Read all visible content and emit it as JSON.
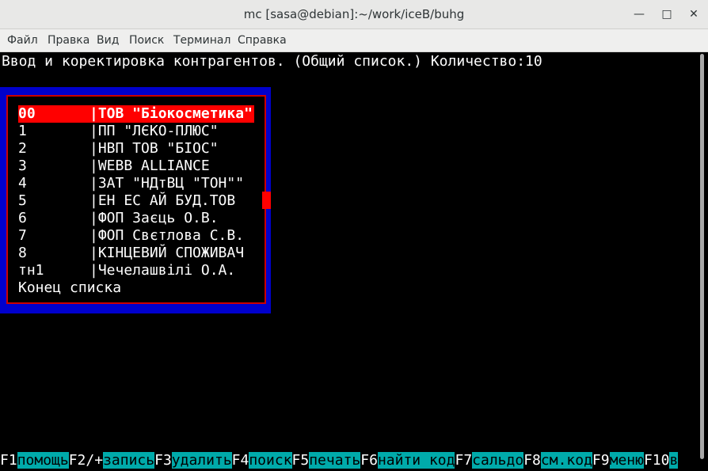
{
  "window": {
    "title": "mc [sasa@debian]:~/work/iceB/buhg"
  },
  "menu": [
    "Файл",
    "Правка",
    "Вид",
    "Поиск",
    "Терминал",
    "Справка"
  ],
  "header": "Ввод и коректировка контрагентов. (Общий список.) Количество:10",
  "list": [
    {
      "code": "00",
      "name": "|ТОВ \"Біокосметика\""
    },
    {
      "code": "1",
      "name": "|ПП \"ЛЄКО-ПЛЮС\""
    },
    {
      "code": "2",
      "name": "|НВП ТОВ \"БІОС\""
    },
    {
      "code": "3",
      "name": "|WEBB ALLIANCE"
    },
    {
      "code": "4",
      "name": "|ЗАТ \"НДтВЦ \"ТОН\"\""
    },
    {
      "code": "5",
      "name": "|ЕН ЕС АЙ БУД.ТОВ"
    },
    {
      "code": "6",
      "name": "|ФОП Заєць О.В."
    },
    {
      "code": "7",
      "name": "|ФОП Свєтлова С.В."
    },
    {
      "code": "8",
      "name": "|КІНЦЕВИЙ СПОЖИВАЧ"
    },
    {
      "code": "тн1",
      "name": "|Чечелашвілі О.А."
    }
  ],
  "list_end": "Конец списка",
  "fkeys": [
    {
      "key": "F1",
      "label": "помощь"
    },
    {
      "key": "F2/+",
      "label": "запись"
    },
    {
      "key": "F3",
      "label": "удалить"
    },
    {
      "key": "F4",
      "label": "поиск"
    },
    {
      "key": "F5",
      "label": "печать"
    },
    {
      "key": "F6",
      "label": "найти код"
    },
    {
      "key": "F7",
      "label": "сальдо"
    },
    {
      "key": "F8",
      "label": "см.код"
    },
    {
      "key": "F9",
      "label": "меню"
    },
    {
      "key": "F10",
      "label": "в"
    }
  ],
  "colors": {
    "selection": "#ff0000",
    "box": "#0000cc",
    "fkey_label_bg": "#00aaaa"
  }
}
